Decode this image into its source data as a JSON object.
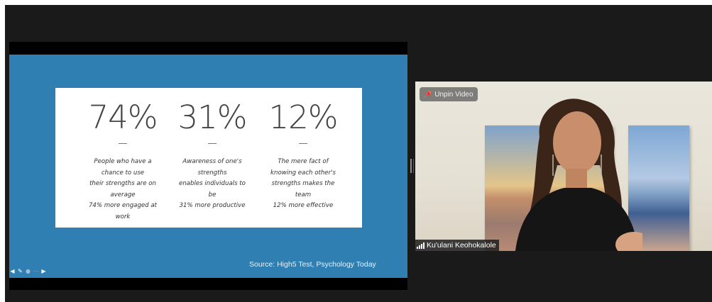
{
  "slide": {
    "stats": [
      {
        "value": "74%",
        "description": "People who have a\nchance to use\ntheir strengths are on\naverage\n74% more engaged at\nwork"
      },
      {
        "value": "31%",
        "description": "Awareness of one's\nstrengths\nenables individuals to\nbe\n31% more productive"
      },
      {
        "value": "12%",
        "description": "The mere fact of\nknowing each other's\nstrengths makes the\nteam\n12% more effective"
      }
    ],
    "source": "Source: High5 Test, Psychology Today",
    "controls": [
      "prev-arrow-icon",
      "pen-icon",
      "circle-icon",
      "menu-icon",
      "next-arrow-icon"
    ],
    "background_color": "#2f7fb3"
  },
  "video": {
    "unpin_label": "Unpin Video",
    "participant_name": "Ku'ulani Keohokalole"
  }
}
